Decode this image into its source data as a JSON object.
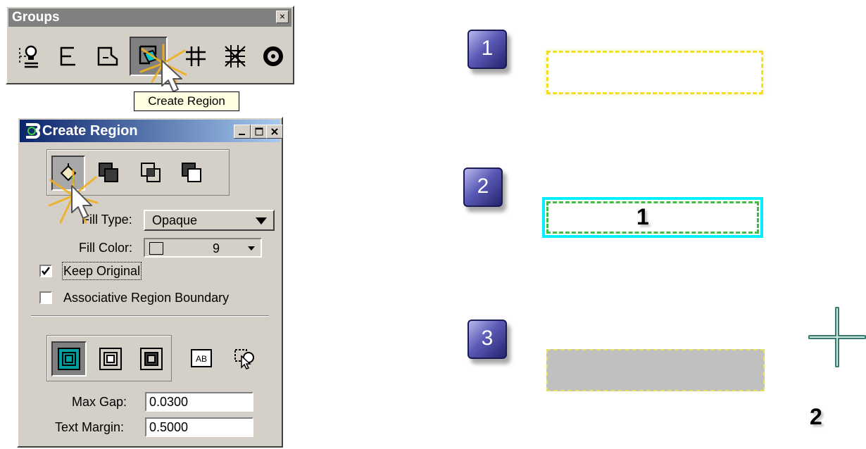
{
  "groups_toolbar": {
    "title": "Groups",
    "close_label": "×",
    "tooltip": "Create Region"
  },
  "dialog": {
    "title": "Create Region",
    "fill_type_label": "Fill Type:",
    "fill_type_value": "Opaque",
    "fill_color_label": "Fill Color:",
    "fill_color_value": "9",
    "keep_original_label": "Keep Original",
    "keep_original_checked": true,
    "associative_label": "Associative Region Boundary",
    "associative_checked": false,
    "max_gap_label": "Max Gap:",
    "max_gap_value": "0.0300",
    "text_margin_label": "Text Margin:",
    "text_margin_value": "0.5000"
  },
  "steps": {
    "step1": "1",
    "step2": "2",
    "step3": "3",
    "rect_label": "1",
    "point_label": "2"
  }
}
